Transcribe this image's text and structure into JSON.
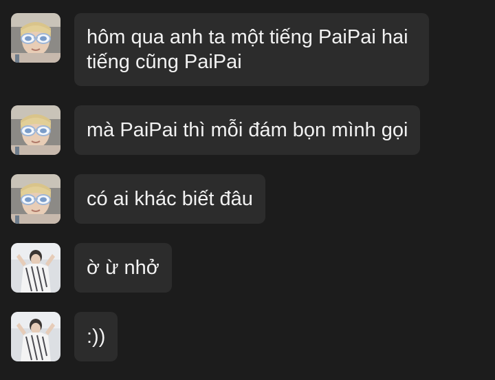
{
  "colors": {
    "background": "#1c1c1c",
    "bubble": "#2c2c2c",
    "text": "#f2f2f2"
  },
  "messages": [
    {
      "avatar": "avatar-sunglasses",
      "text": "hôm qua anh ta một tiếng PaiPai hai tiếng cũng PaiPai"
    },
    {
      "avatar": "avatar-sunglasses",
      "text": "mà PaiPai thì mỗi đám bọn mình gọi"
    },
    {
      "avatar": "avatar-sunglasses",
      "text": "có ai khác biết đâu"
    },
    {
      "avatar": "avatar-striped-shirt",
      "text": "ờ ừ nhở"
    },
    {
      "avatar": "avatar-striped-shirt",
      "text": ":))"
    }
  ]
}
